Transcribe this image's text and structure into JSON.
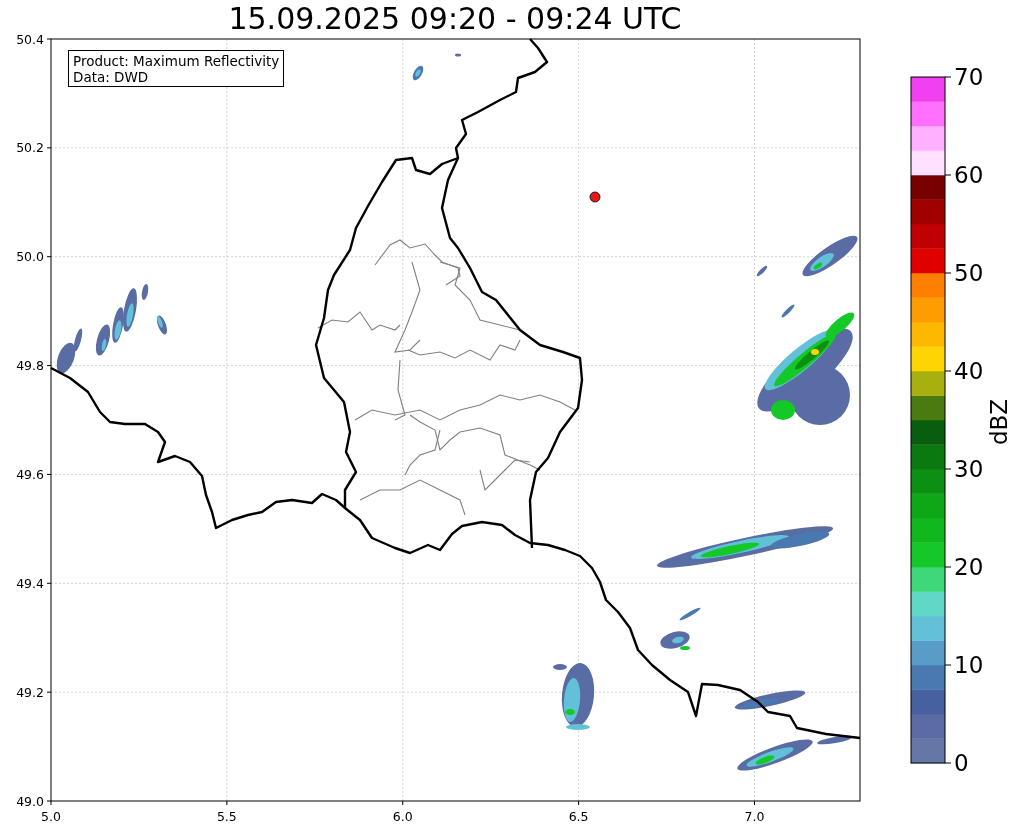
{
  "title": "15.09.2025 09:20 - 09:24 UTC",
  "map": {
    "info_box": [
      "Product: Maximum Reflectivity",
      "Data: DWD"
    ],
    "xticks": [
      "5.0",
      "5.5",
      "6.0",
      "6.5",
      "7.0"
    ],
    "yticks": [
      "50.4",
      "50.2",
      "50.0",
      "49.8",
      "49.6",
      "49.4",
      "49.2",
      "49.0"
    ]
  },
  "colorbar": {
    "label": "dBZ",
    "ticks": [
      "70",
      "60",
      "50",
      "40",
      "30",
      "20",
      "10",
      "0"
    ],
    "bands": [
      {
        "color": "#6478a8"
      },
      {
        "color": "#5a6ca4"
      },
      {
        "color": "#4660a0"
      },
      {
        "color": "#4a78b0"
      },
      {
        "color": "#5a9cc8"
      },
      {
        "color": "#62c0d8"
      },
      {
        "color": "#60d8c8"
      },
      {
        "color": "#3ed878"
      },
      {
        "color": "#14c828"
      },
      {
        "color": "#10b81c"
      },
      {
        "color": "#0ea816"
      },
      {
        "color": "#0c9012"
      },
      {
        "color": "#0a7a10"
      },
      {
        "color": "#085e0e"
      },
      {
        "color": "#4a7a10"
      },
      {
        "color": "#a8b010"
      },
      {
        "color": "#ffd400"
      },
      {
        "color": "#ffb800"
      },
      {
        "color": "#ff9c00"
      },
      {
        "color": "#ff8000"
      },
      {
        "color": "#e00000"
      },
      {
        "color": "#c00000"
      },
      {
        "color": "#a00000"
      },
      {
        "color": "#780000"
      },
      {
        "color": "#ffe0ff"
      },
      {
        "color": "#ffb0ff"
      },
      {
        "color": "#ff70ff"
      },
      {
        "color": "#f040f0"
      }
    ]
  }
}
